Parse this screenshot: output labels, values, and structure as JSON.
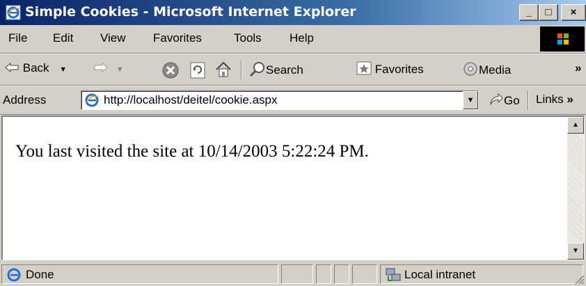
{
  "window": {
    "title": "Simple Cookies - Microsoft Internet Explorer",
    "controls": {
      "minimize": "_",
      "maximize": "□",
      "close": "×"
    }
  },
  "menu": [
    "File",
    "Edit",
    "View",
    "Favorites",
    "Tools",
    "Help"
  ],
  "toolbar": {
    "back_label": "Back",
    "search_label": "Search",
    "favorites_label": "Favorites",
    "media_label": "Media",
    "overflow": "»"
  },
  "address_bar": {
    "label": "Address",
    "url": "http://localhost/deitel/cookie.aspx",
    "go_label": "Go",
    "links_label": "Links",
    "links_overflow": "»"
  },
  "page": {
    "message": "You last visited the site at 10/14/2003 5:22:24 PM."
  },
  "status_bar": {
    "status": "Done",
    "zone": "Local intranet"
  },
  "colors": {
    "title_start": "#0a246a",
    "title_end": "#a6caf0",
    "chrome": "#d4d0c8",
    "ie_icon": "#1e6fd6"
  },
  "icons": [
    "ie-logo-icon",
    "back-arrow-icon",
    "forward-arrow-icon",
    "stop-icon",
    "refresh-icon",
    "home-icon",
    "search-icon",
    "favorites-icon",
    "media-icon",
    "go-arrow-icon",
    "local-intranet-icon",
    "windows-flag-icon"
  ]
}
